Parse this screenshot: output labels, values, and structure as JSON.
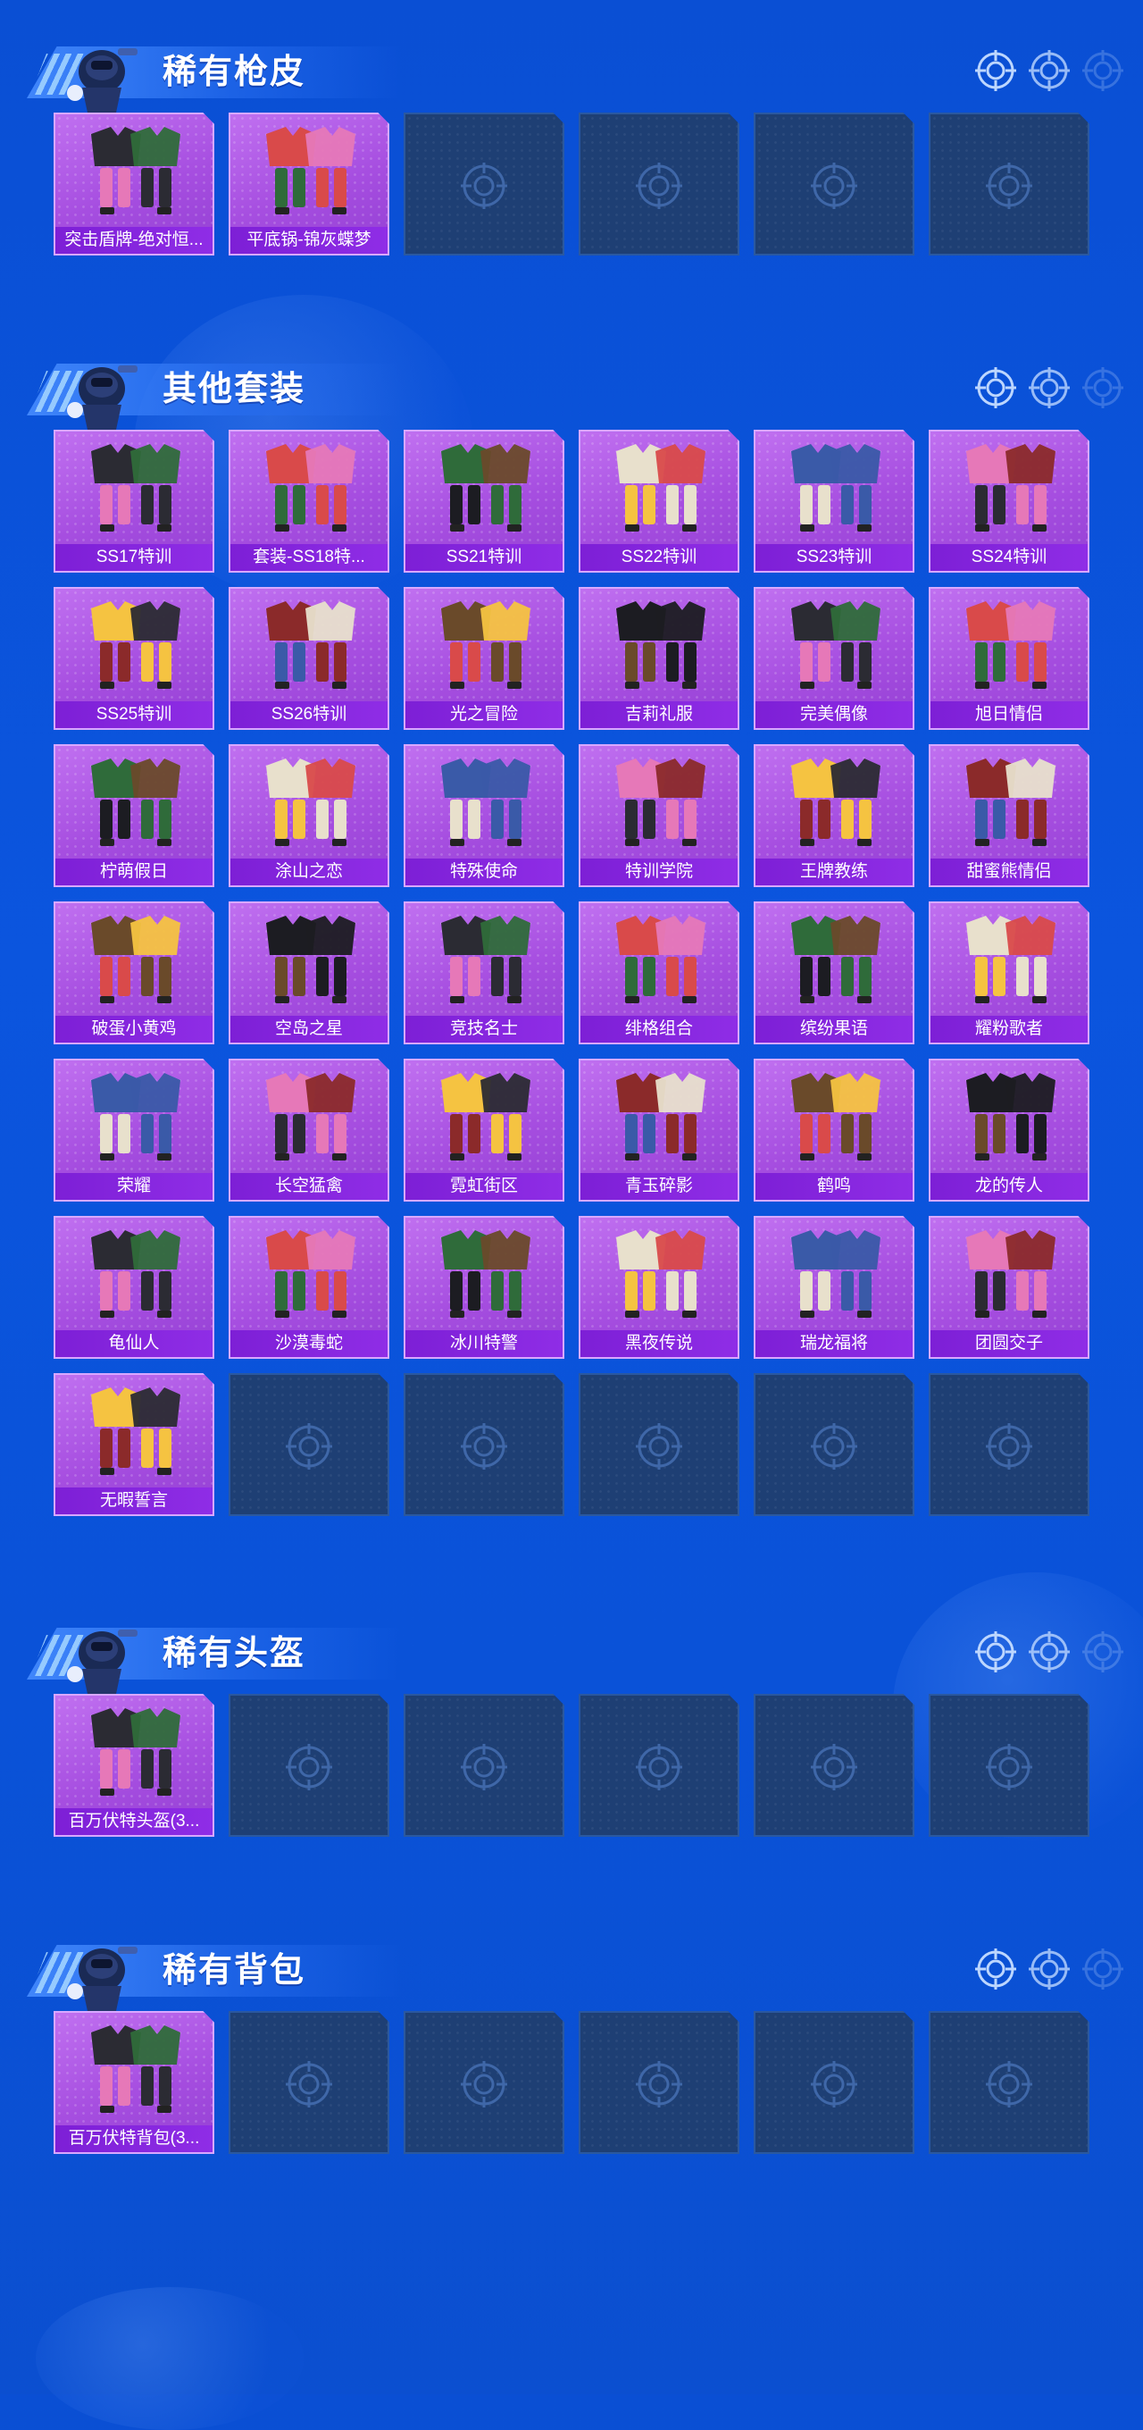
{
  "sections": [
    {
      "title": "稀有枪皮",
      "items": [
        "突击盾牌-绝对恒...",
        "平底锅-锦灰蝶梦"
      ],
      "slots": 6
    },
    {
      "title": "其他套装",
      "items": [
        "SS17特训",
        "套装-SS18特...",
        "SS21特训",
        "SS22特训",
        "SS23特训",
        "SS24特训",
        "SS25特训",
        "SS26特训",
        "光之冒险",
        "吉莉礼服",
        "完美偶像",
        "旭日情侣",
        "柠萌假日",
        "涂山之恋",
        "特殊使命",
        "特训学院",
        "王牌教练",
        "甜蜜熊情侣",
        "破蛋小黄鸡",
        "空岛之星",
        "竞技名士",
        "绯格组合",
        "缤纷果语",
        "耀粉歌者",
        "荣耀",
        "长空猛禽",
        "霓虹街区",
        "青玉碎影",
        "鹤鸣",
        "龙的传人",
        "龟仙人",
        "沙漠毒蛇",
        "冰川特警",
        "黑夜传说",
        "瑞龙福将",
        "团圆交子",
        "无暇誓言"
      ],
      "slots": 42
    },
    {
      "title": "稀有头盔",
      "items": [
        "百万伏特头盔(3..."
      ],
      "slots": 6
    },
    {
      "title": "稀有背包",
      "items": [
        "百万伏特背包(3..."
      ],
      "slots": 6
    }
  ],
  "colors": {
    "background": "#0a4fd4",
    "card_filled": "#a64ee0",
    "card_label": "#7d1fd6",
    "card_empty": "#1e3f74"
  }
}
